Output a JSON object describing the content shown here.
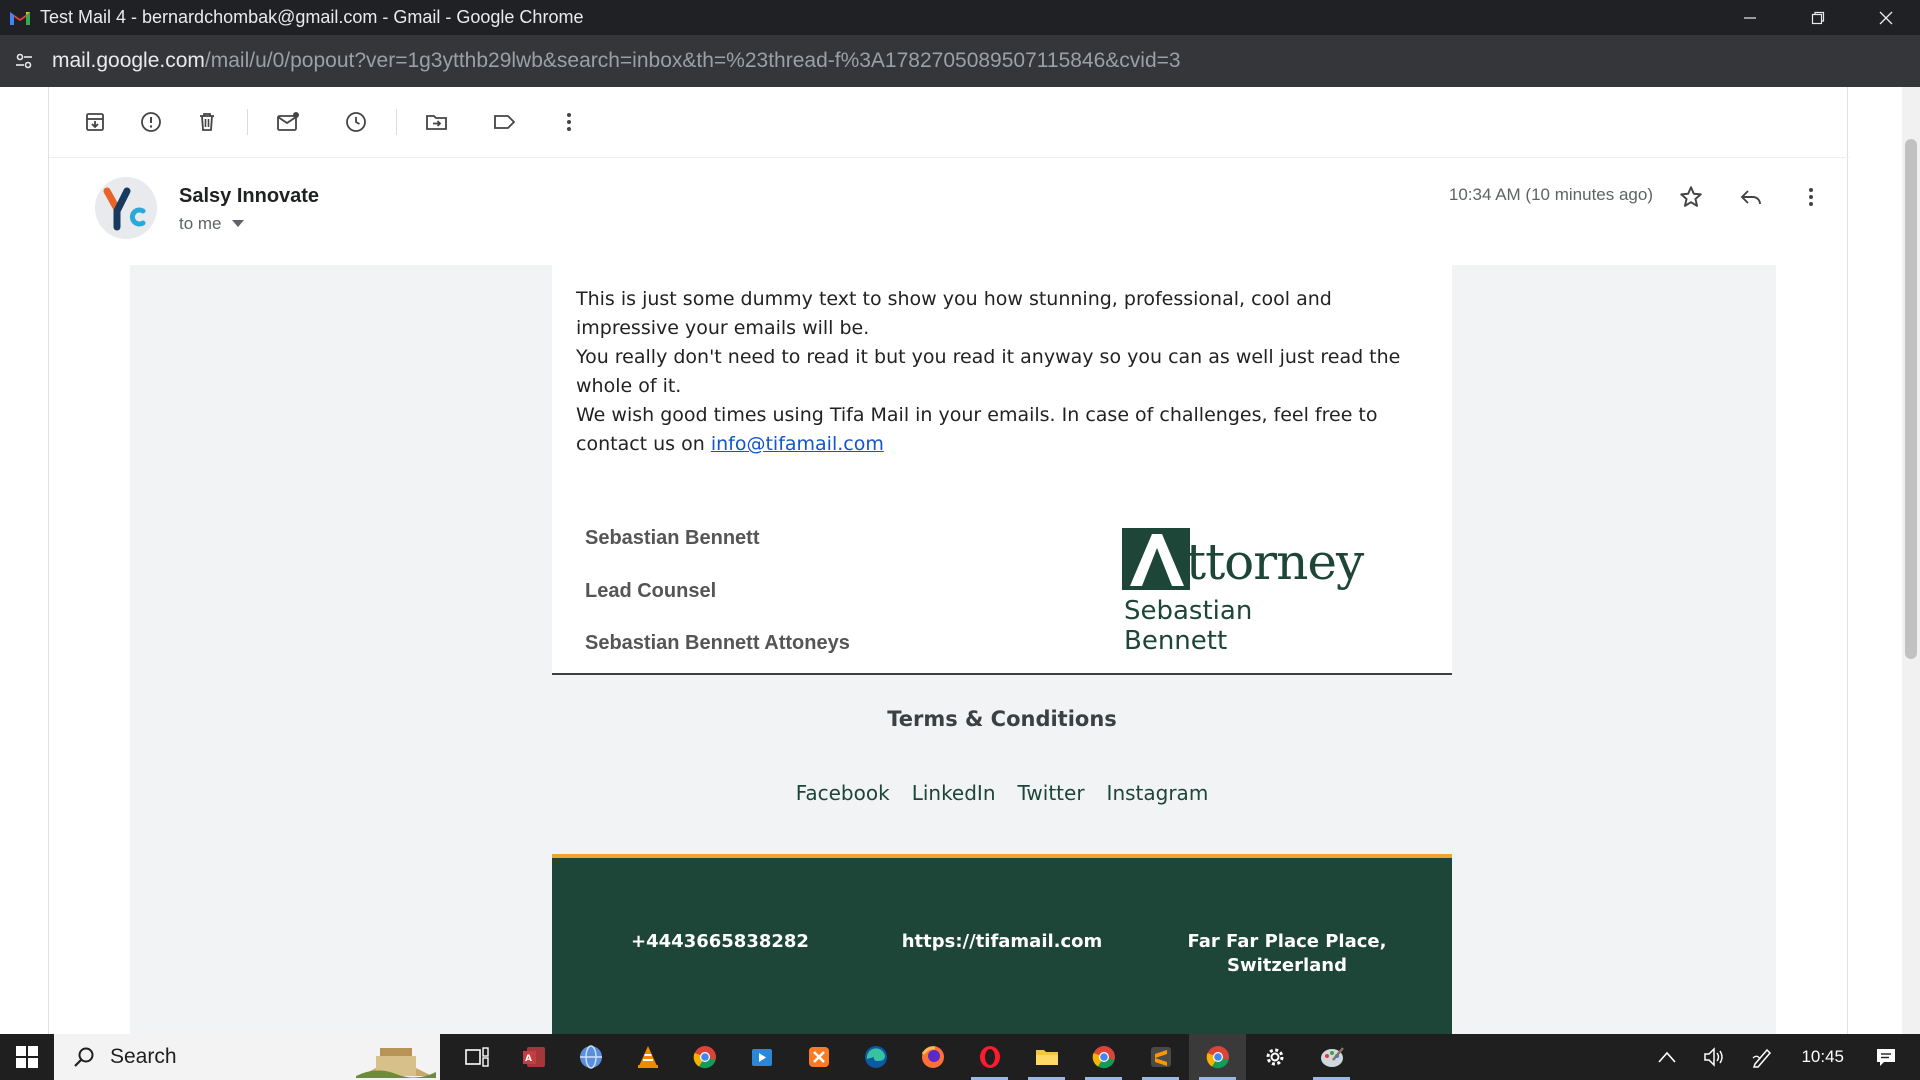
{
  "window": {
    "title": "Test Mail 4 - bernardchombak@gmail.com - Gmail - Google Chrome"
  },
  "address_bar": {
    "host": "mail.google.com",
    "path": "/mail/u/0/popout?ver=1g3ytthb29lwb&search=inbox&th=%23thread-f%3A1782705089507115846&cvid=3"
  },
  "toolbar": {
    "icons": [
      "archive-icon",
      "report-spam-icon",
      "delete-icon",
      "mark-unread-icon",
      "snooze-icon",
      "move-to-icon",
      "label-icon",
      "more-vert-icon"
    ]
  },
  "message": {
    "sender": "Salsy Innovate",
    "recipient": "to me",
    "timestamp": "10:34 AM (10 minutes ago)"
  },
  "email": {
    "paragraph1": "This is just some dummy text to show you how stunning, professional, cool and impressive your emails will be.",
    "paragraph2": "You really don't need to read it but you read it anyway so you can as well just read the whole of it.",
    "paragraph3_prefix": "We wish good times using Tifa Mail in your emails. In case of challenges, feel free to contact us on ",
    "contact_link": "info@tifamail.com",
    "signature": {
      "name": "Sebastian Bennett",
      "role": "Lead Counsel",
      "firm": "Sebastian Bennett Attoneys"
    },
    "logo": {
      "main_text": "ttorney",
      "sub_text": "Sebastian Bennett"
    },
    "terms": "Terms & Conditions",
    "socials": [
      "Facebook",
      "LinkedIn",
      "Twitter",
      "Instagram"
    ],
    "footer": {
      "phone": "+4443665838282",
      "website": "https://tifamail.com",
      "address_line1": "Far Far Place Place,",
      "address_line2": "Switzerland"
    },
    "colors": {
      "brand_green": "#1e4638",
      "accent_orange": "#f0a32e",
      "link_blue": "#1155cc"
    }
  },
  "taskbar": {
    "search_label": "Search",
    "clock": "10:45"
  }
}
